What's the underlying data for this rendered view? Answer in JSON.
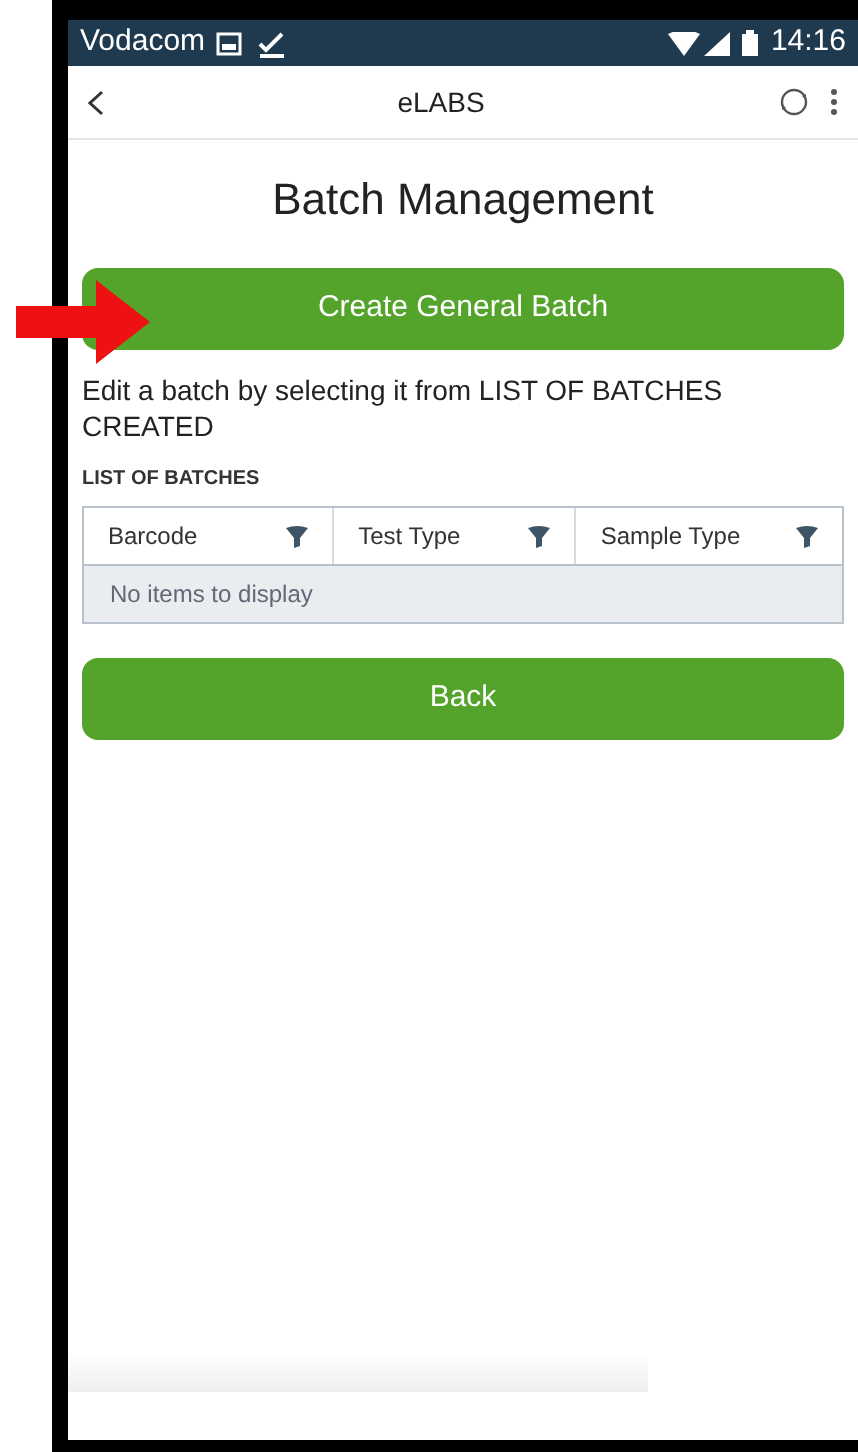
{
  "status_bar": {
    "carrier": "Vodacom",
    "time": "14:16"
  },
  "app_bar": {
    "title": "eLABS"
  },
  "page_title": "Batch Management",
  "create_button": "Create General Batch",
  "instruction": "Edit a batch by selecting it from LIST OF BATCHES CREATED",
  "list_heading": "LIST OF BATCHES",
  "table": {
    "columns": [
      {
        "label": "Barcode"
      },
      {
        "label": "Test Type"
      },
      {
        "label": "Sample Type"
      }
    ],
    "empty_message": "No items to display"
  },
  "back_button": "Back"
}
